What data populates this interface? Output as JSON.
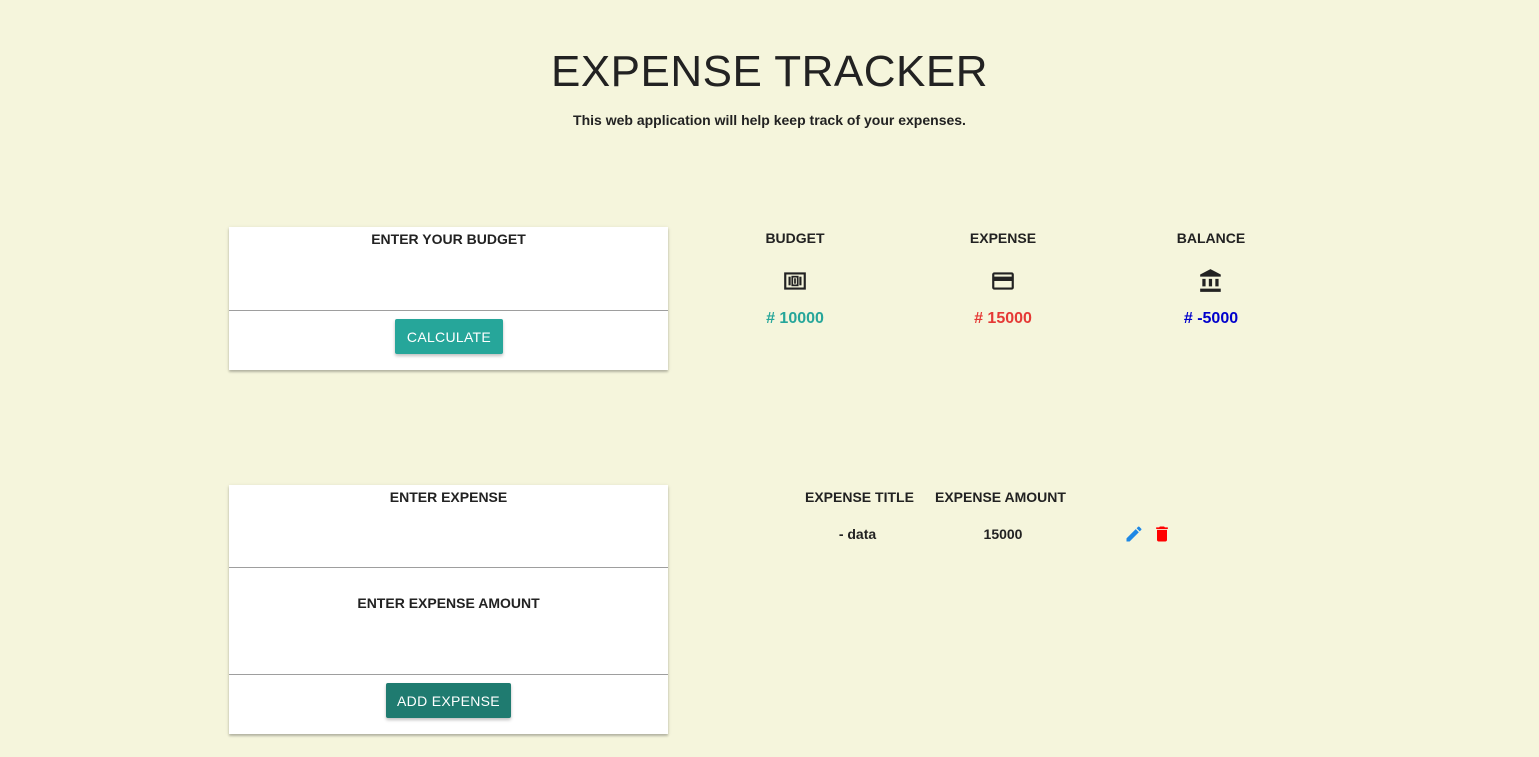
{
  "header": {
    "title": "EXPENSE TRACKER",
    "subtitle": "This web application will help keep track of your expenses."
  },
  "budget_form": {
    "label": "ENTER YOUR BUDGET",
    "input_value": "",
    "button_label": "CALCULATE"
  },
  "summary": {
    "budget": {
      "label": "BUDGET",
      "value": "# 10000",
      "icon": "money-icon",
      "color": "#26a69a"
    },
    "expense": {
      "label": "EXPENSE",
      "value": "# 15000",
      "icon": "credit-card-icon",
      "color": "#e53935"
    },
    "balance": {
      "label": "BALANCE",
      "value": "# -5000",
      "icon": "bank-icon",
      "color": "#0000cc"
    }
  },
  "expense_form": {
    "title_label": "ENTER EXPENSE",
    "title_value": "",
    "amount_label": "ENTER EXPENSE AMOUNT",
    "amount_value": "",
    "button_label": "ADD EXPENSE"
  },
  "expense_table": {
    "headers": [
      "EXPENSE TITLE",
      "EXPENSE AMOUNT"
    ],
    "rows": [
      {
        "title": "- data",
        "amount": "15000",
        "actions": [
          "edit-icon",
          "delete-icon"
        ]
      }
    ]
  },
  "colors": {
    "background": "#f5f5dc",
    "calculate_button": "#26a69a",
    "add_button": "#1f7b70",
    "edit_icon": "#1e88e5",
    "delete_icon": "#ff0000"
  }
}
